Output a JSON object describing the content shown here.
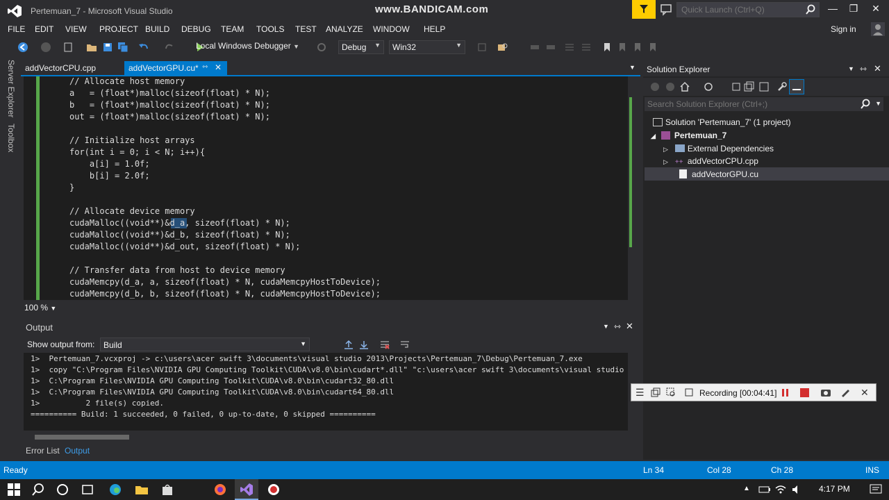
{
  "window": {
    "title": "Pertemuan_7 - Microsoft Visual Studio",
    "watermark": "www.BANDICAM.com",
    "quick_launch_placeholder": "Quick Launch (Ctrl+Q)"
  },
  "menu": [
    "FILE",
    "EDIT",
    "VIEW",
    "PROJECT",
    "BUILD",
    "DEBUG",
    "TEAM",
    "TOOLS",
    "TEST",
    "ANALYZE",
    "WINDOW",
    "HELP"
  ],
  "signin": "Sign in",
  "toolbar": {
    "debugger_label": "Local Windows Debugger",
    "config": "Debug",
    "platform": "Win32"
  },
  "left_tabs": [
    "Server Explorer",
    "Toolbox"
  ],
  "doc_tabs": [
    {
      "label": "addVectorCPU.cpp",
      "active": false
    },
    {
      "label": "addVectorGPU.cu*",
      "active": true
    }
  ],
  "code_lines": [
    "// Allocate host memory",
    "a   = (float*)malloc(sizeof(float) * N);",
    "b   = (float*)malloc(sizeof(float) * N);",
    "out = (float*)malloc(sizeof(float) * N);",
    "",
    "// Initialize host arrays",
    "for(int i = 0; i < N; i++){",
    "    a[i] = 1.0f;",
    "    b[i] = 2.0f;",
    "}",
    "",
    "// Allocate device memory",
    "cudaMalloc((void**)&d_a, sizeof(float) * N);",
    "cudaMalloc((void**)&d_b, sizeof(float) * N);",
    "cudaMalloc((void**)&d_out, sizeof(float) * N);",
    "",
    "// Transfer data from host to device memory",
    "cudaMemcpy(d_a, a, sizeof(float) * N, cudaMemcpyHostToDevice);",
    "cudaMemcpy(d_b, b, sizeof(float) * N, cudaMemcpyHostToDevice);"
  ],
  "zoom": "100 %",
  "output": {
    "title": "Output",
    "show_from_label": "Show output from:",
    "source": "Build",
    "lines": [
      "1>  Pertemuan_7.vcxproj -> c:\\users\\acer swift 3\\documents\\visual studio 2013\\Projects\\Pertemuan_7\\Debug\\Pertemuan_7.exe",
      "1>  copy \"C:\\Program Files\\NVIDIA GPU Computing Toolkit\\CUDA\\v8.0\\bin\\cudart*.dll\" \"c:\\users\\acer swift 3\\documents\\visual studio",
      "1>  C:\\Program Files\\NVIDIA GPU Computing Toolkit\\CUDA\\v8.0\\bin\\cudart32_80.dll",
      "1>  C:\\Program Files\\NVIDIA GPU Computing Toolkit\\CUDA\\v8.0\\bin\\cudart64_80.dll",
      "1>          2 file(s) copied.",
      "========== Build: 1 succeeded, 0 failed, 0 up-to-date, 0 skipped =========="
    ]
  },
  "bottom_tabs": [
    "Error List",
    "Output"
  ],
  "solution_explorer": {
    "title": "Solution Explorer",
    "search_placeholder": "Search Solution Explorer (Ctrl+;)",
    "solution": "Solution 'Pertemuan_7' (1 project)",
    "project": "Pertemuan_7",
    "items": [
      "External Dependencies",
      "addVectorCPU.cpp",
      "addVectorGPU.cu"
    ]
  },
  "recording": "Recording [00:04:41]",
  "status": {
    "state": "Ready",
    "ln": "Ln 34",
    "col": "Col 28",
    "ch": "Ch 28",
    "mode": "INS"
  },
  "taskbar": {
    "time": "4:17 PM"
  },
  "colors": {
    "accent": "#007acc",
    "editor_bg": "#1e1e1e",
    "change_bar": "#57a64a",
    "notify": "#ffcc00"
  }
}
